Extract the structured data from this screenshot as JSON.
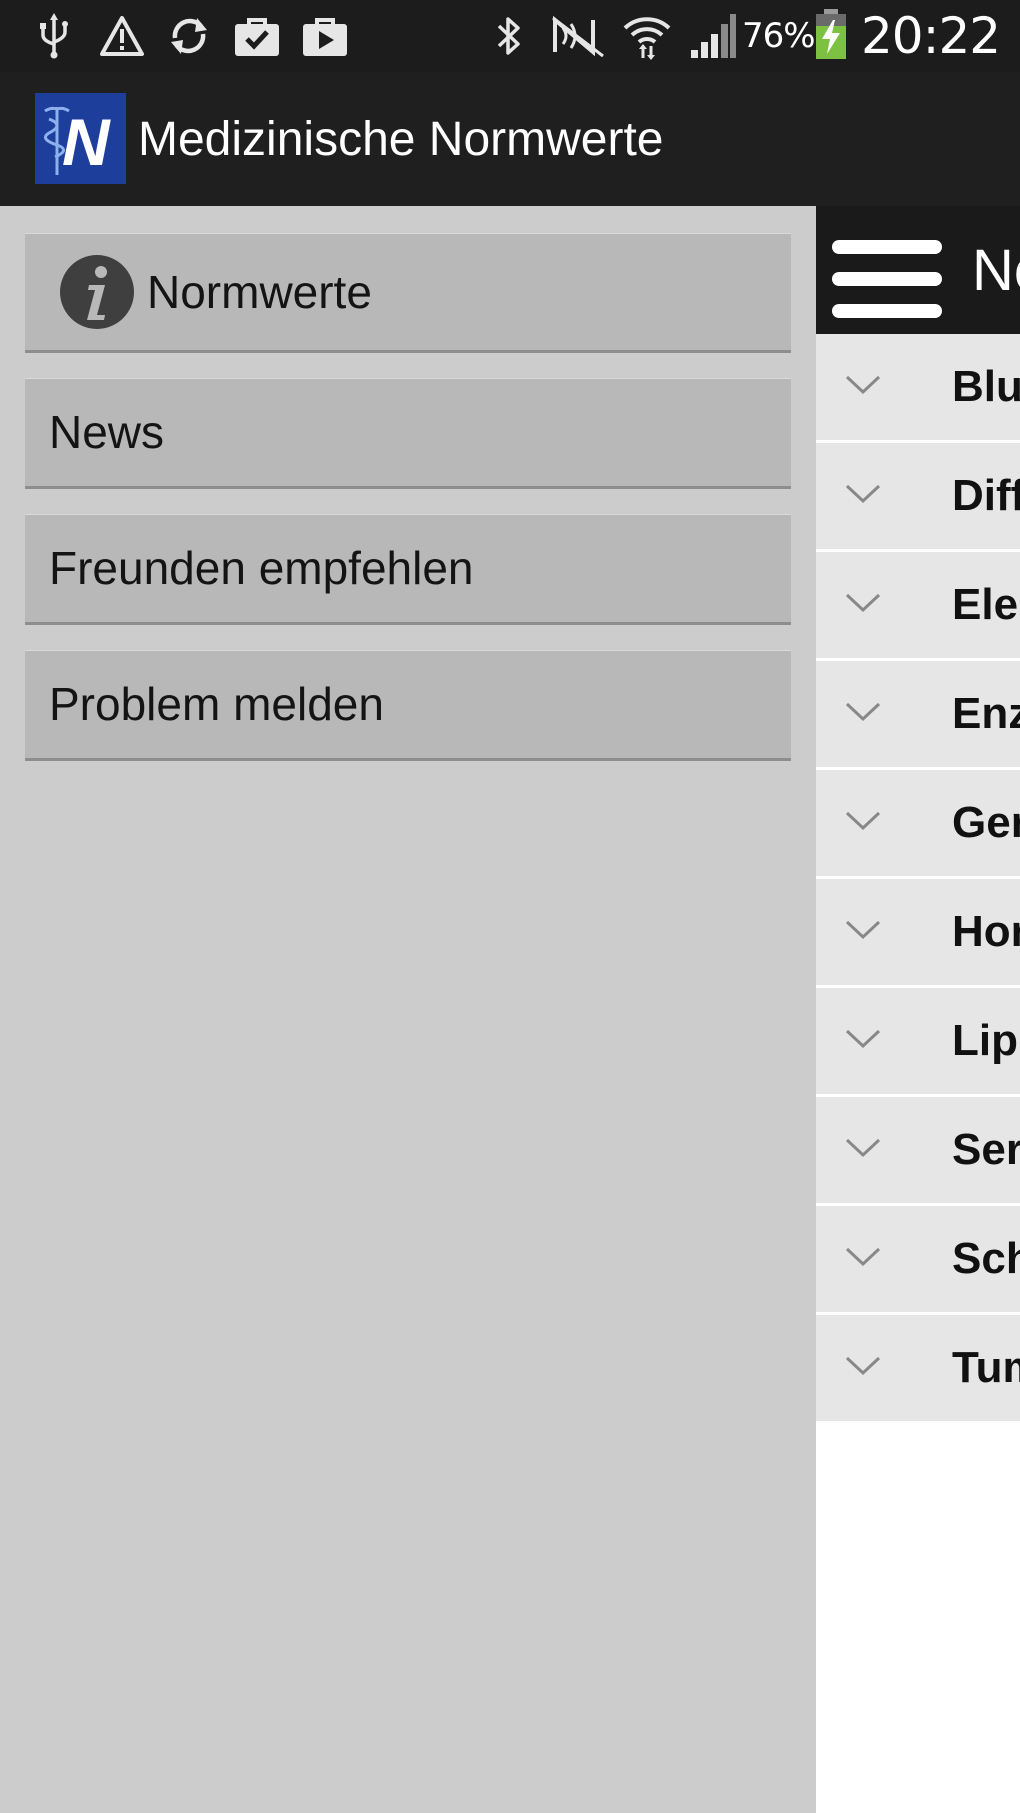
{
  "status_bar": {
    "battery_percent": "76%",
    "time": "20:22",
    "icons": [
      "usb-icon",
      "warning-icon",
      "sync-icon",
      "store-check-icon",
      "play-store-icon",
      "bluetooth-icon",
      "nfc-icon",
      "wifi-icon",
      "signal-icon",
      "battery-charging-icon"
    ]
  },
  "action_bar": {
    "app_title": "Medizinische Normwerte",
    "logo_letter": "N"
  },
  "drawer": {
    "items": [
      {
        "label": "Normwerte",
        "icon": "info-icon"
      },
      {
        "label": "News"
      },
      {
        "label": "Freunden empfehlen"
      },
      {
        "label": "Problem melden"
      }
    ]
  },
  "content": {
    "header_title": "Normwerte",
    "categories": [
      {
        "label": "Blutbild"
      },
      {
        "label": "Differentialblutbild"
      },
      {
        "label": "Elektrolyte"
      },
      {
        "label": "Enzyme"
      },
      {
        "label": "Gerinnung"
      },
      {
        "label": "Hormone"
      },
      {
        "label": "Lipide"
      },
      {
        "label": "Serum"
      },
      {
        "label": "Schilddrüse"
      },
      {
        "label": "Tumormarker"
      }
    ]
  },
  "colors": {
    "status_bar_bg": "#1c1c1c",
    "action_bar_bg": "#1f1f1f",
    "logo_blue": "#1e3e9c",
    "drawer_bg": "#cccccc",
    "drawer_item_bg": "#b8b8b8",
    "battery_green": "#7dc142"
  }
}
